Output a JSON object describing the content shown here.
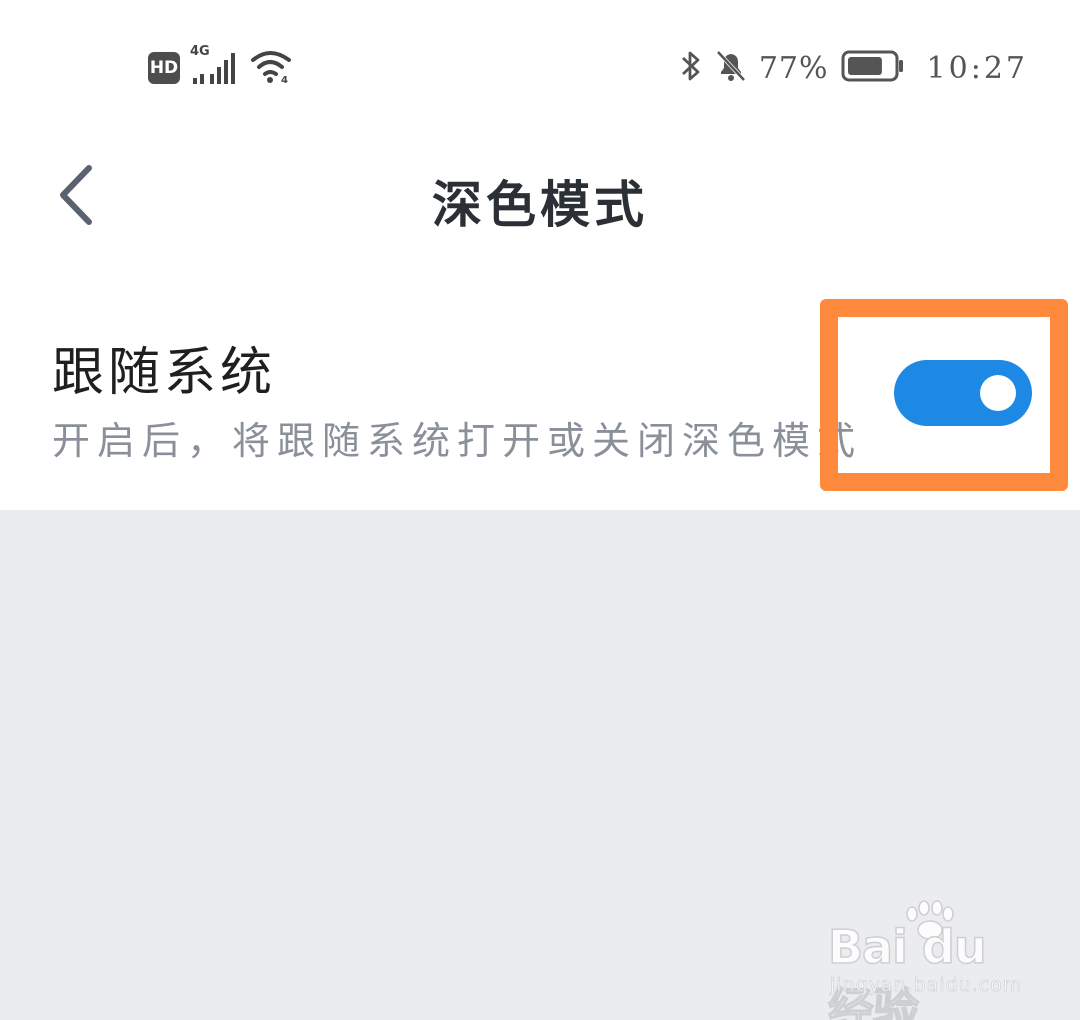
{
  "status_bar": {
    "hd_badge": "HD",
    "network_type": "4G",
    "battery_percent": "77%",
    "battery_level": 0.77,
    "time": "10:27",
    "icons": [
      "hd-icon",
      "signal-icon",
      "wifi-icon",
      "bluetooth-icon",
      "bell-off-icon",
      "battery-icon"
    ]
  },
  "header": {
    "back_icon": "chevron-left-icon",
    "title": "深色模式"
  },
  "setting": {
    "title": "跟随系统",
    "description": "开启后，将跟随系统打开或关闭深色模式",
    "toggle_on": true
  },
  "watermark": {
    "brand": "Bai du 经验",
    "url": "jingyan.baidu.com"
  },
  "colors": {
    "accent": "#1e88e5",
    "highlight": "#ff8a3d",
    "background_gray": "#ebecee",
    "title_text": "#2b2f36",
    "secondary_text": "#8a9099"
  }
}
